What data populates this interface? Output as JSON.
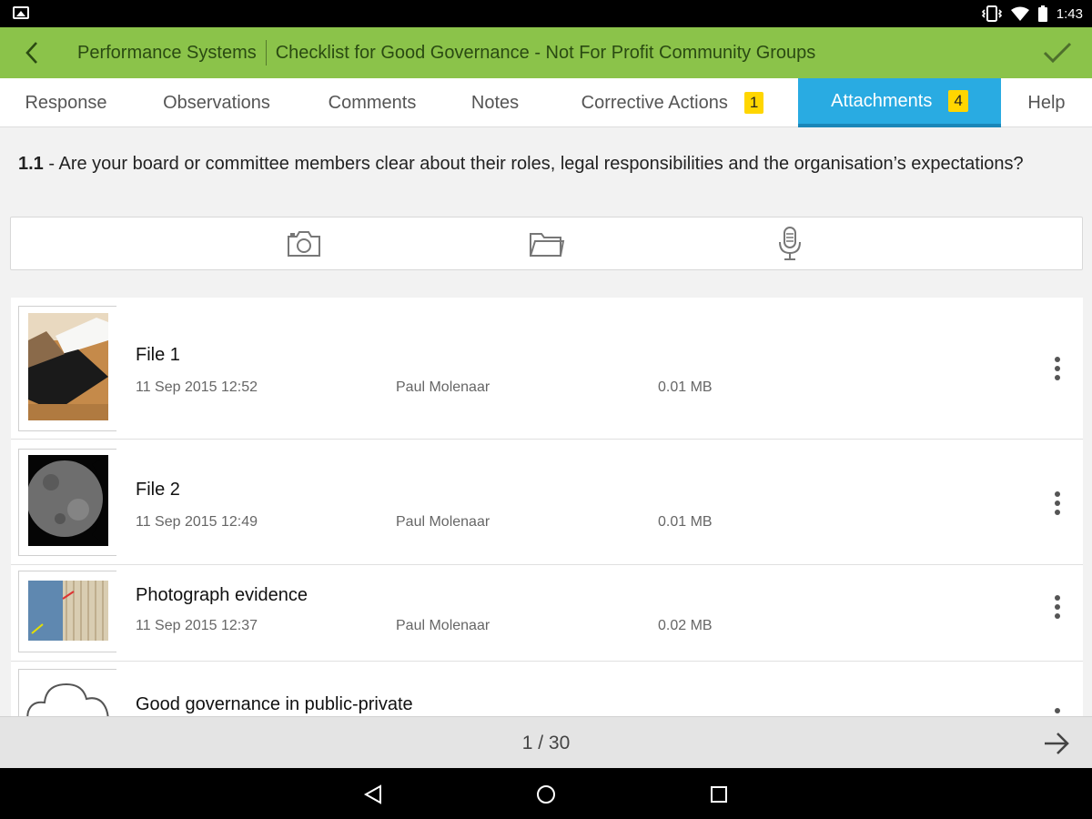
{
  "status_bar": {
    "time": "1:43"
  },
  "app_bar": {
    "app_name": "Performance Systems",
    "checklist_title": "Checklist for Good Governance - Not For Profit Community Groups"
  },
  "tabs": [
    {
      "label": "Response"
    },
    {
      "label": "Observations"
    },
    {
      "label": "Comments"
    },
    {
      "label": "Notes"
    },
    {
      "label": "Corrective Actions",
      "badge": "1"
    },
    {
      "label": "Attachments",
      "badge": "4",
      "active": true
    },
    {
      "label": "Help"
    }
  ],
  "question": {
    "number": "1.1",
    "separator": " - ",
    "text": "Are your board or committee members clear about their roles, legal responsibilities and the organisation’s expectations?"
  },
  "toolbar": {
    "icons": [
      "camera-icon",
      "folder-icon",
      "microphone-icon"
    ]
  },
  "attachments": [
    {
      "name": "File 1",
      "date": "11 Sep 2015 12:52",
      "author": "Paul Molenaar",
      "size": "0.01 MB"
    },
    {
      "name": "File 2",
      "date": "11 Sep 2015 12:49",
      "author": "Paul Molenaar",
      "size": "0.01 MB"
    },
    {
      "name": "Photograph evidence",
      "date": "11 Sep 2015 12:37",
      "author": "Paul Molenaar",
      "size": "0.02 MB"
    },
    {
      "name": "Good governance in public-private",
      "date": "",
      "author": "",
      "size": ""
    }
  ],
  "pager": {
    "indicator": "1 / 30"
  },
  "colors": {
    "app_bar": "#8bc34a",
    "active_tab": "#29abe2",
    "badge": "#ffd600"
  }
}
